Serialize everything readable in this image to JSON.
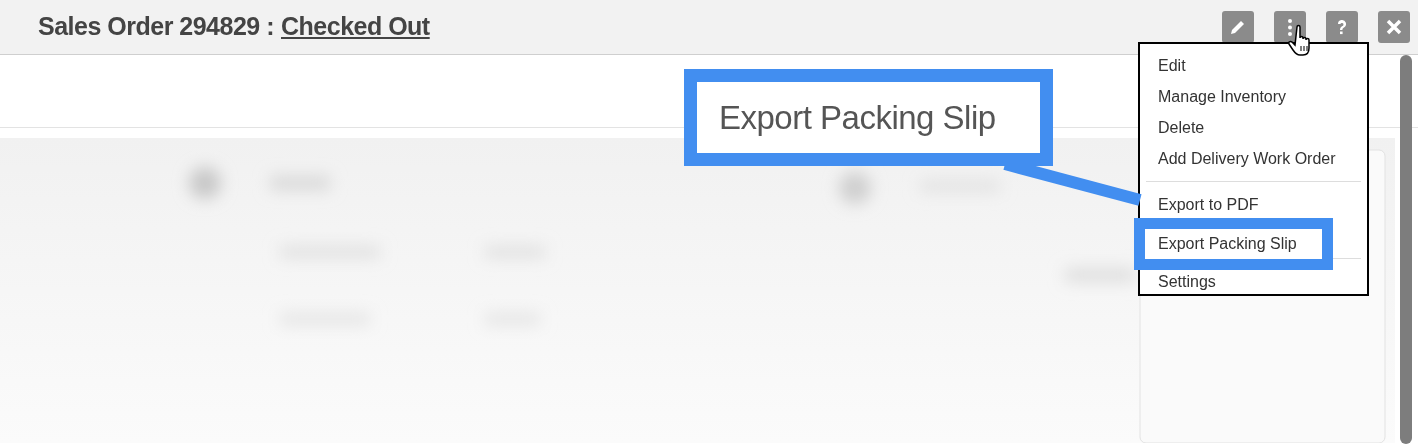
{
  "header": {
    "title": "Sales Order 294829 :",
    "status": "Checked Out"
  },
  "toolbar": [
    {
      "kind": "edit"
    },
    {
      "kind": "more"
    },
    {
      "kind": "help"
    },
    {
      "kind": "close"
    }
  ],
  "menu": {
    "items": [
      {
        "kind": "item",
        "label": "Edit",
        "highlighted": false
      },
      {
        "kind": "item",
        "label": "Manage Inventory",
        "highlighted": false
      },
      {
        "kind": "item",
        "label": "Delete",
        "highlighted": false
      },
      {
        "kind": "item",
        "label": "Add Delivery Work Order",
        "highlighted": false
      },
      {
        "kind": "separator"
      },
      {
        "kind": "item",
        "label": "Export to PDF",
        "highlighted": false
      },
      {
        "kind": "item",
        "label": "Export Packing Slip",
        "highlighted": true
      },
      {
        "kind": "separator"
      },
      {
        "kind": "item",
        "label": "Settings",
        "highlighted": false
      }
    ]
  },
  "callout": {
    "label": "Export Packing Slip"
  }
}
